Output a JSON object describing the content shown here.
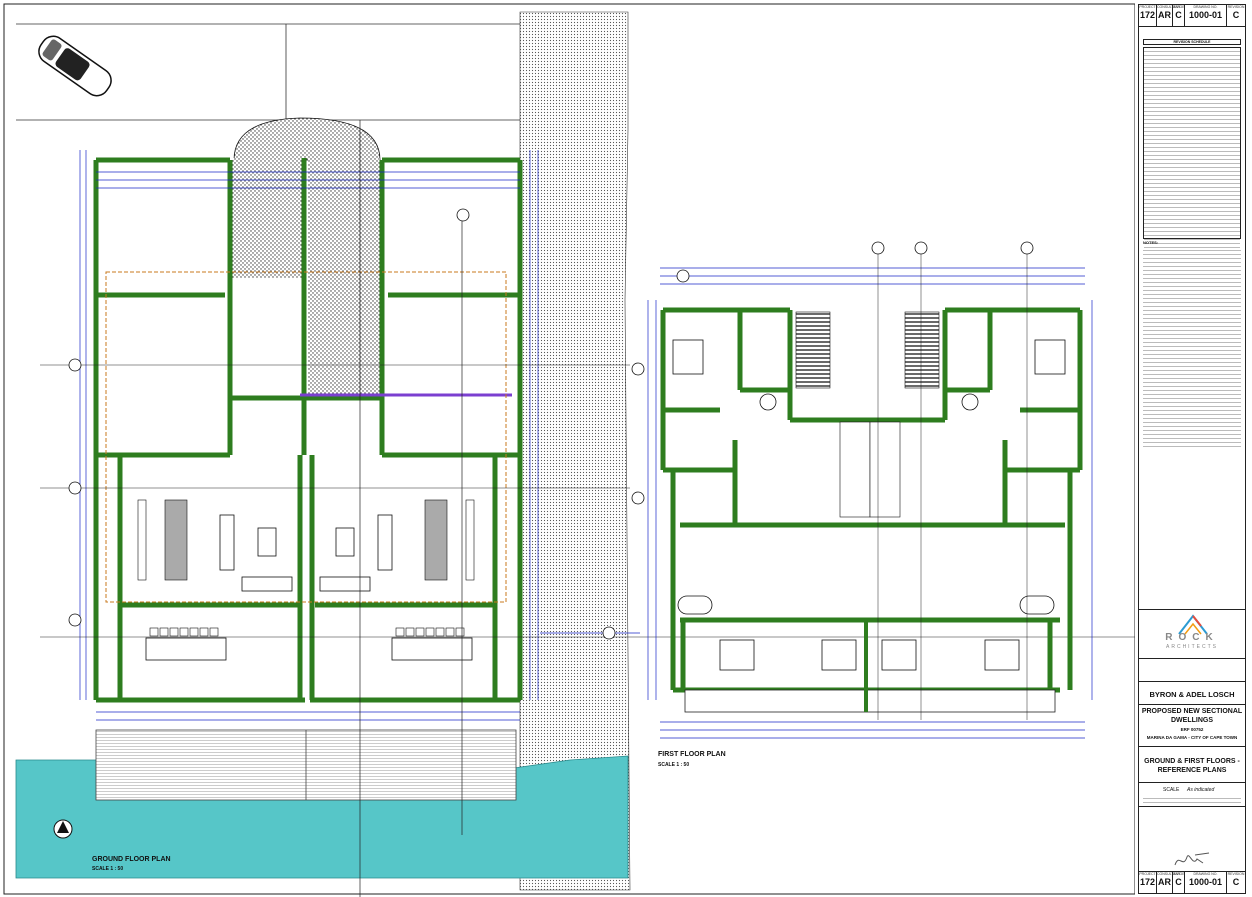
{
  "ground_floor": {
    "title": "GROUND FLOOR PLAN",
    "scale": "SCALE 1 : 50"
  },
  "first_floor": {
    "title": "FIRST FLOOR PLAN",
    "scale": "SCALE 1 : 50"
  },
  "title_block": {
    "top_strip": {
      "project_label": "PROJECT",
      "project": "172",
      "consultant_label": "CONSULTANT",
      "consultant": "AR",
      "stage_label": "STAGE",
      "stage": "C",
      "drawing_no_label": "DRAWING NO.",
      "drawing_no": "1000-01",
      "revision_label": "REVISION",
      "revision": "C"
    },
    "revision_schedule_title": "REVISION SCHEDULE",
    "notes_title": "NOTES:",
    "firm_name": "ROCK",
    "firm_sub": "ARCHITECTS",
    "client": "BYRON & ADEL LOSCH",
    "project_title": "PROPOSED NEW SECTIONAL DWELLINGS",
    "erf": "ERF 00752",
    "location": "MARINA DA GAMA - CITY OF CAPE TOWN",
    "drawing_title": "GROUND & FIRST FLOORS - REFERENCE PLANS",
    "scale_label": "SCALE",
    "scale_value": "As indicated"
  },
  "colors": {
    "wall": "#2e7d1f",
    "dim": "#1a27c9",
    "water": "#56c6c8",
    "hatch": "#444444",
    "red_line": "#c0392b"
  }
}
